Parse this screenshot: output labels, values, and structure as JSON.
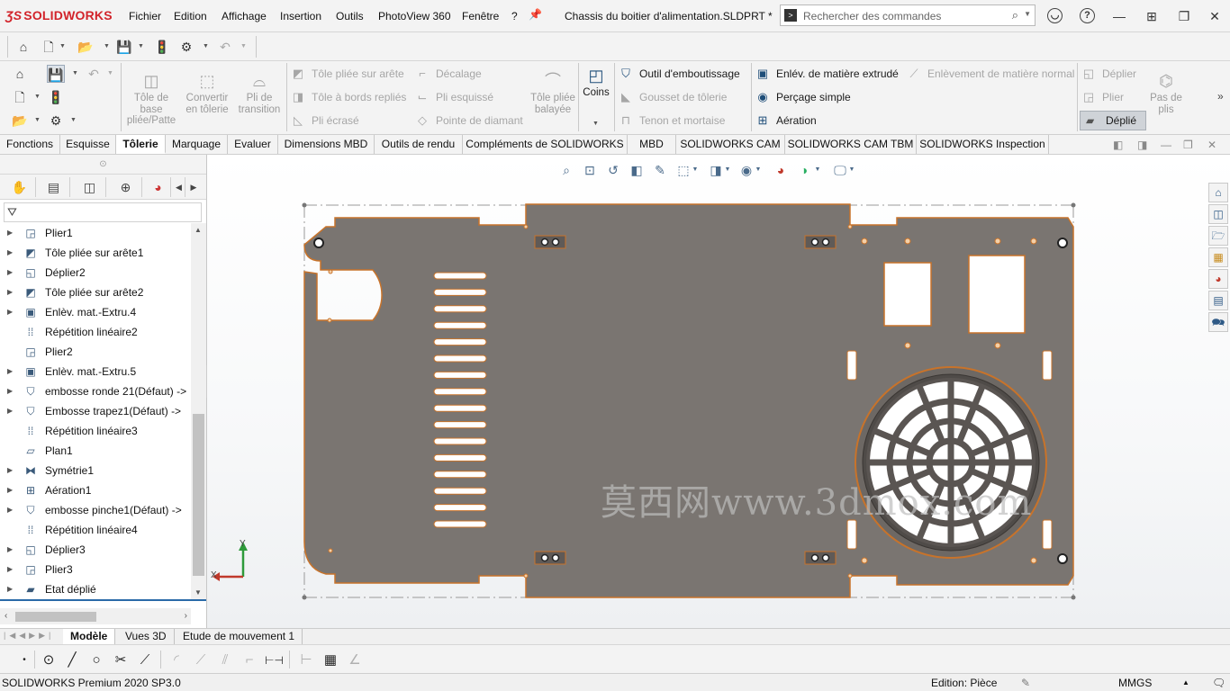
{
  "app": {
    "logo_text": "SOLIDWORKS",
    "document_title": "Chassis du boitier d'alimentation.SLDPRT *",
    "brand_color": "#d2232a"
  },
  "menu": [
    "Fichier",
    "Edition",
    "Affichage",
    "Insertion",
    "Outils",
    "PhotoView 360",
    "Fenêtre",
    "?"
  ],
  "search": {
    "placeholder": "Rechercher des commandes"
  },
  "ribbon": {
    "big_buttons": [
      {
        "label": "Tôle de base pliée/Patte",
        "icon": "base-flange-icon",
        "enabled": false
      },
      {
        "label": "Convertir en tôlerie",
        "icon": "convert-sheet-metal-icon",
        "enabled": false
      },
      {
        "label": "Pli de transition",
        "icon": "lofted-bend-icon",
        "enabled": false
      }
    ],
    "col1": [
      {
        "label": "Tôle pliée sur arête",
        "icon": "edge-flange-icon",
        "enabled": false
      },
      {
        "label": "Tôle à bords repliés",
        "icon": "hem-icon",
        "enabled": false
      },
      {
        "label": "Pli écrasé",
        "icon": "crushed-bend-icon",
        "enabled": false
      }
    ],
    "col2": [
      {
        "label": "Décalage",
        "icon": "jog-icon",
        "enabled": false
      },
      {
        "label": "Pli esquissé",
        "icon": "sketched-bend-icon",
        "enabled": false
      },
      {
        "label": "Pointe de diamant",
        "icon": "cross-break-icon",
        "enabled": false
      }
    ],
    "swept_flange": {
      "label": "Tôle pliée balayée",
      "icon": "swept-flange-icon",
      "enabled": false
    },
    "corners": {
      "label": "Coins",
      "icon": "corners-icon",
      "enabled": true
    },
    "col3": [
      {
        "label": "Outil d'emboutissage",
        "icon": "forming-tool-icon",
        "enabled": true
      },
      {
        "label": "Gousset de tôlerie",
        "icon": "gusset-icon",
        "enabled": false
      },
      {
        "label": "Tenon et mortaise",
        "icon": "tab-slot-icon",
        "enabled": false
      }
    ],
    "col4": [
      {
        "label": "Enlév. de matière extrudé",
        "icon": "extruded-cut-icon",
        "enabled": true
      },
      {
        "label": "Perçage simple",
        "icon": "simple-hole-icon",
        "enabled": true
      },
      {
        "label": "Aération",
        "icon": "vent-icon",
        "enabled": true
      }
    ],
    "normal_cut": {
      "label": "Enlèvement de matière normal",
      "icon": "normal-cut-icon",
      "enabled": false
    },
    "col5": [
      {
        "label": "Déplier",
        "icon": "unfold-icon",
        "enabled": false
      },
      {
        "label": "Plier",
        "icon": "fold-icon",
        "enabled": false
      }
    ],
    "no_bends": {
      "label": "Pas de plis",
      "icon": "no-bends-icon",
      "enabled": false
    },
    "flatten": {
      "label": "Déplié",
      "icon": "flatten-icon",
      "enabled": true,
      "pressed": true
    }
  },
  "tabs": [
    {
      "label": "Fonctions",
      "active": false
    },
    {
      "label": "Esquisse",
      "active": false
    },
    {
      "label": "Tôlerie",
      "active": true
    },
    {
      "label": "Marquage",
      "active": false
    },
    {
      "label": "Evaluer",
      "active": false
    },
    {
      "label": "Dimensions MBD",
      "active": false
    },
    {
      "label": "Outils de rendu",
      "active": false
    },
    {
      "label": "Compléments de SOLIDWORKS",
      "active": false
    },
    {
      "label": "MBD",
      "active": false
    },
    {
      "label": "SOLIDWORKS CAM",
      "active": false
    },
    {
      "label": "SOLIDWORKS CAM TBM",
      "active": false
    },
    {
      "label": "SOLIDWORKS Inspection",
      "active": false
    }
  ],
  "tree": [
    {
      "label": "Plier1",
      "icon": "fold-icon",
      "expandable": true
    },
    {
      "label": "Tôle pliée sur arête1",
      "icon": "edge-flange-icon",
      "expandable": true
    },
    {
      "label": "Déplier2",
      "icon": "unfold-icon",
      "expandable": true
    },
    {
      "label": "Tôle pliée sur arête2",
      "icon": "edge-flange-icon",
      "expandable": true
    },
    {
      "label": "Enlèv. mat.-Extru.4",
      "icon": "extruded-cut-icon",
      "expandable": true
    },
    {
      "label": "Répétition linéaire2",
      "icon": "linear-pattern-icon",
      "expandable": false
    },
    {
      "label": "Plier2",
      "icon": "fold-icon",
      "expandable": false
    },
    {
      "label": "Enlèv. mat.-Extru.5",
      "icon": "extruded-cut-icon",
      "expandable": true
    },
    {
      "label": "embosse ronde 21(Défaut) ->",
      "icon": "forming-tool-icon",
      "expandable": true
    },
    {
      "label": "Embosse trapez1(Défaut) ->",
      "icon": "forming-tool-icon",
      "expandable": true
    },
    {
      "label": "Répétition linéaire3",
      "icon": "linear-pattern-icon",
      "expandable": false
    },
    {
      "label": "Plan1",
      "icon": "plane-icon",
      "expandable": false
    },
    {
      "label": "Symétrie1",
      "icon": "mirror-icon",
      "expandable": true
    },
    {
      "label": "Aération1",
      "icon": "vent-icon",
      "expandable": true
    },
    {
      "label": "embosse pinche1(Défaut) ->",
      "icon": "forming-tool-icon",
      "expandable": true
    },
    {
      "label": "Répétition linéaire4",
      "icon": "linear-pattern-icon",
      "expandable": false
    },
    {
      "label": "Déplier3",
      "icon": "unfold-icon",
      "expandable": true
    },
    {
      "label": "Plier3",
      "icon": "fold-icon",
      "expandable": true
    },
    {
      "label": "Etat déplié",
      "icon": "flat-pattern-icon",
      "expandable": true
    }
  ],
  "viewport": {
    "watermark": "莫西网www.3dmox.com",
    "axis_y": "Y",
    "axis_x": "X",
    "part_color": "#7a7571",
    "edge_color": "#c8732a"
  },
  "bottom_tabs": [
    {
      "label": "Modèle",
      "active": true
    },
    {
      "label": "Vues 3D",
      "active": false
    },
    {
      "label": "Etude de mouvement 1",
      "active": false
    }
  ],
  "status": {
    "version": "SOLIDWORKS Premium 2020 SP3.0",
    "mode": "Edition: Pièce",
    "units": "MMGS"
  }
}
